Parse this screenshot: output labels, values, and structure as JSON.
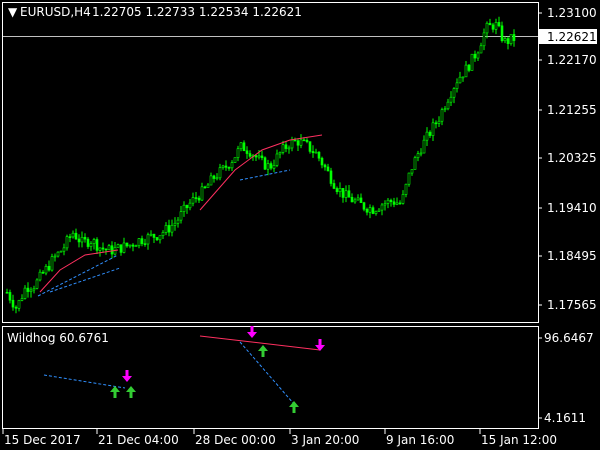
{
  "header": {
    "symbol_caret": "▼",
    "symbol": "EURUSD,H4",
    "ohlc": "1.22705 1.22733 1.22534 1.22621"
  },
  "colors": {
    "background": "#000000",
    "candle": "#00ff00",
    "axis": "#ffffff",
    "grid_price_line": "#c0c0c0",
    "trendline_pink": "#ff3060",
    "trendline_blue": "#3090ff",
    "arrow_down": "#ff00ff",
    "arrow_up": "#33cc33"
  },
  "chart_data": [
    {
      "type": "candlestick",
      "title": "EURUSD,H4",
      "y_ticks": [
        "1.23100",
        "1.22170",
        "1.21255",
        "1.20325",
        "1.19410",
        "1.18495",
        "1.17565"
      ],
      "ylim": [
        1.1718,
        1.233
      ],
      "current_price": "1.22621",
      "close_path": [
        1.1775,
        1.1745,
        1.1785,
        1.179,
        1.1815,
        1.184,
        1.186,
        1.189,
        1.187,
        1.1875,
        1.186,
        1.1855,
        1.186,
        1.1865,
        1.1875,
        1.188,
        1.1885,
        1.1895,
        1.191,
        1.1935,
        1.1955,
        1.197,
        1.1995,
        1.201,
        1.203,
        1.2055,
        1.2045,
        1.2025,
        1.2015,
        1.204,
        1.206,
        1.2065,
        1.2055,
        1.204,
        1.201,
        1.198,
        1.196,
        1.195,
        1.194,
        1.1935,
        1.1945,
        1.195,
        1.1945,
        1.201,
        1.205,
        1.208,
        1.211,
        1.215,
        1.2185,
        1.2205,
        1.2235,
        1.228,
        1.229,
        1.2255,
        1.2262
      ]
    },
    {
      "type": "indicator",
      "title": "Wildhog 60.6761",
      "y_ticks": [
        "96.6467",
        "4.1611"
      ],
      "ylim": [
        4.1611,
        96.6467
      ]
    }
  ],
  "x_axis": {
    "labels": [
      "15 Dec 2017",
      "21 Dec 04:00",
      "28 Dec 00:00",
      "3 Jan 20:00",
      "9 Jan 16:00",
      "15 Jan 12:00"
    ]
  }
}
